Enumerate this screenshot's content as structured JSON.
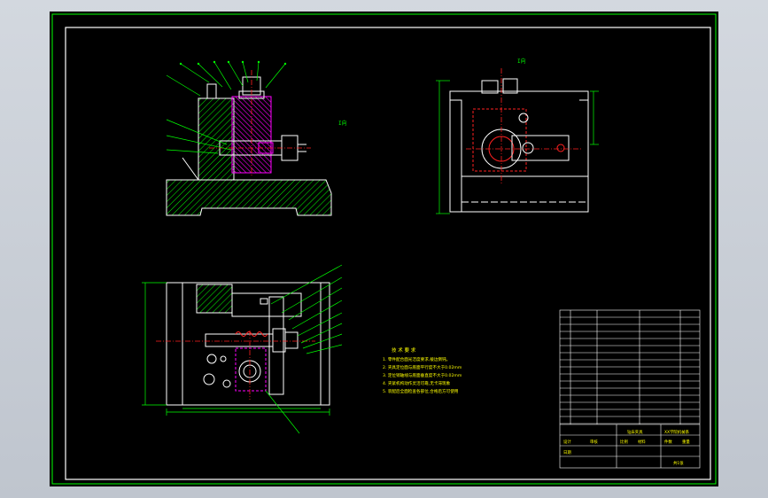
{
  "window": {
    "background": "#c9ced6"
  },
  "colors": {
    "sheet": "#000000",
    "green": "#00ff00",
    "line": "#ffffff",
    "cyan": "#00ffff",
    "red": "#ff2020",
    "magenta": "#ff00ff",
    "yellow": "#ffff00"
  },
  "views": {
    "front_label": "I向",
    "side_label": "I向"
  },
  "notes": {
    "heading": "技 术 要 求",
    "lines": [
      "1. 零件配合面光洁度要求,棱边倒钝。",
      "2. 夹具定位面与底面平行度不大于0.02mm",
      "3. 定位销轴线与底面垂直度不大于0.02mm",
      "4. 夹紧机构动作灵活可靠,无卡滞现象",
      "5. 装配后全面检查各部位,合格后方可使用"
    ]
  },
  "title_block": {
    "drawing_name": "钻床夹具",
    "school": "XX学院机械系",
    "label_scale": "比例",
    "label_material": "材料",
    "label_qty": "件数",
    "label_weight": "重量",
    "label_designer": "设计",
    "label_checker": "审核",
    "label_date": "日期",
    "sheet": "共1张"
  }
}
